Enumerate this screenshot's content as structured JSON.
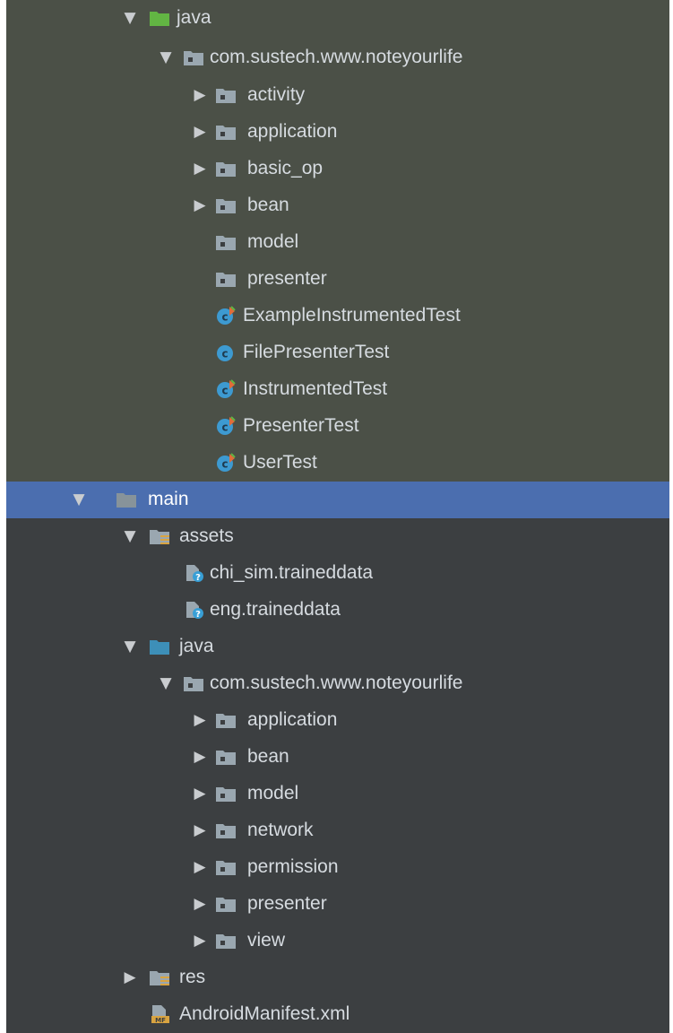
{
  "project_tree": {
    "rows": [
      {
        "label": "java",
        "icon": "folder-green-icon",
        "arrow": "▼"
      },
      {
        "label": "com.sustech.www.noteyourlife",
        "icon": "package-folder-icon",
        "arrow": "▼"
      },
      {
        "label": "activity",
        "icon": "package-folder-icon",
        "arrow": "▶"
      },
      {
        "label": "application",
        "icon": "package-folder-icon",
        "arrow": "▶"
      },
      {
        "label": "basic_op",
        "icon": "package-folder-icon",
        "arrow": "▶"
      },
      {
        "label": "bean",
        "icon": "package-folder-icon",
        "arrow": "▶"
      },
      {
        "label": "model",
        "icon": "package-folder-icon",
        "arrow": ""
      },
      {
        "label": "presenter",
        "icon": "package-folder-icon",
        "arrow": ""
      },
      {
        "label": "ExampleInstrumentedTest",
        "icon": "test-class-icon",
        "arrow": ""
      },
      {
        "label": "FilePresenterTest",
        "icon": "class-icon",
        "arrow": ""
      },
      {
        "label": "InstrumentedTest",
        "icon": "test-class-icon",
        "arrow": ""
      },
      {
        "label": "PresenterTest",
        "icon": "test-class-icon",
        "arrow": ""
      },
      {
        "label": "UserTest",
        "icon": "test-class-icon",
        "arrow": ""
      },
      {
        "label": "main",
        "icon": "folder-icon",
        "arrow": "▼",
        "selected": true
      },
      {
        "label": "assets",
        "icon": "resources-folder-icon",
        "arrow": "▼"
      },
      {
        "label": "chi_sim.traineddata",
        "icon": "unknown-file-icon",
        "arrow": ""
      },
      {
        "label": "eng.traineddata",
        "icon": "unknown-file-icon",
        "arrow": ""
      },
      {
        "label": "java",
        "icon": "folder-blue-icon",
        "arrow": "▼"
      },
      {
        "label": "com.sustech.www.noteyourlife",
        "icon": "package-folder-icon",
        "arrow": "▼"
      },
      {
        "label": "application",
        "icon": "package-folder-icon",
        "arrow": "▶"
      },
      {
        "label": "bean",
        "icon": "package-folder-icon",
        "arrow": "▶"
      },
      {
        "label": "model",
        "icon": "package-folder-icon",
        "arrow": "▶"
      },
      {
        "label": "network",
        "icon": "package-folder-icon",
        "arrow": "▶"
      },
      {
        "label": "permission",
        "icon": "package-folder-icon",
        "arrow": "▶"
      },
      {
        "label": "presenter",
        "icon": "package-folder-icon",
        "arrow": "▶"
      },
      {
        "label": "view",
        "icon": "package-folder-icon",
        "arrow": "▶"
      },
      {
        "label": "res",
        "icon": "resources-folder-icon",
        "arrow": "▶"
      },
      {
        "label": "AndroidManifest.xml",
        "icon": "manifest-file-icon",
        "arrow": ""
      }
    ]
  },
  "colors": {
    "test_area_bg": "#4b5047",
    "panel_bg": "#3c3f41",
    "selection_bg": "#4b6eaf",
    "text": "#d6dbe0",
    "folder_green": "#62b543",
    "folder_blue": "#3d8fb8",
    "folder_grey": "#9aa7b0",
    "class_blue": "#3d9ad1",
    "test_marker": "#e06c3a",
    "help_blue": "#389fd6",
    "resources_yellow": "#d9a441"
  }
}
